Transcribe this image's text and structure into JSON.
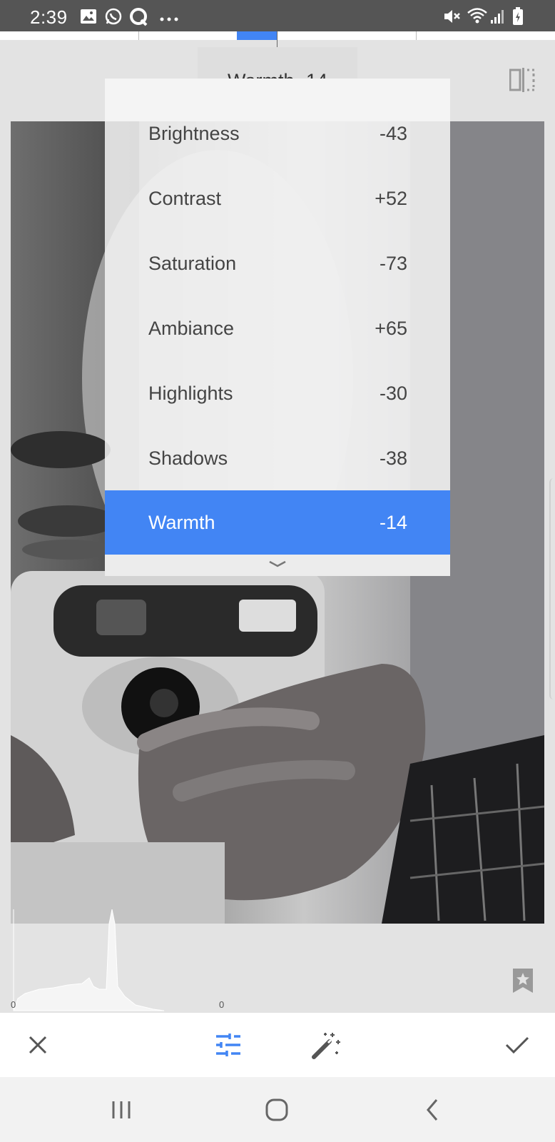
{
  "status_bar": {
    "time": "2:39",
    "icons": [
      "image-icon",
      "whatsapp-icon",
      "q-app-icon",
      "more-icon",
      "mute-icon",
      "wifi-icon",
      "signal-icon",
      "battery-icon"
    ]
  },
  "adjustment_pill": {
    "label": "Warmth -14"
  },
  "adjust_menu": {
    "items": [
      {
        "label": "Brightness",
        "value": "-43"
      },
      {
        "label": "Contrast",
        "value": "+52"
      },
      {
        "label": "Saturation",
        "value": "-73"
      },
      {
        "label": "Ambiance",
        "value": "+65"
      },
      {
        "label": "Highlights",
        "value": "-30"
      },
      {
        "label": "Shadows",
        "value": "-38"
      },
      {
        "label": "Warmth",
        "value": "-14",
        "selected": true
      }
    ]
  },
  "histogram": {
    "left_label": "0",
    "right_label": "0"
  },
  "toolbar": {
    "buttons": [
      "close-icon",
      "tune-icon",
      "auto-magic-icon",
      "check-icon"
    ],
    "accent_color": "#4285f4"
  },
  "nav_bar": {
    "buttons": [
      "recent-apps-icon",
      "home-icon",
      "back-icon"
    ]
  }
}
